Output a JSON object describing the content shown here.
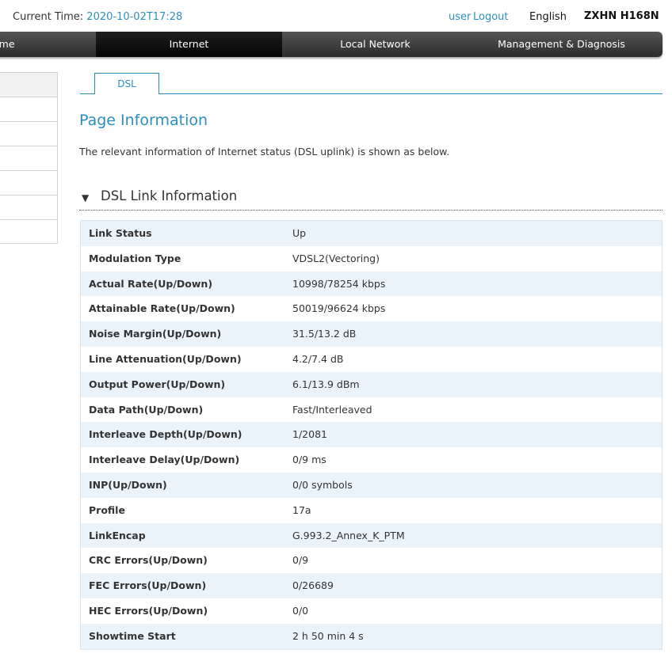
{
  "header": {
    "current_time_label": "Current Time:",
    "current_time_value": "2020-10-02T17:28",
    "user": "user",
    "logout": "Logout",
    "language": "English",
    "model": "ZXHN H168N"
  },
  "nav": {
    "items": [
      {
        "label": "ome"
      },
      {
        "label": "Internet",
        "active": true
      },
      {
        "label": "Local Network"
      },
      {
        "label": "Management & Diagnosis"
      }
    ]
  },
  "tabs": [
    {
      "label": "DSL",
      "active": true
    }
  ],
  "page": {
    "title": "Page Information",
    "description": "The relevant information of Internet status (DSL uplink) is shown as below."
  },
  "section": {
    "toggle_icon": "triangle-down-icon",
    "title": "DSL Link Information"
  },
  "dsl_info": [
    {
      "label": "Link Status",
      "value": "Up"
    },
    {
      "label": "Modulation Type",
      "value": "VDSL2(Vectoring)"
    },
    {
      "label": "Actual Rate(Up/Down)",
      "value": "10998/78254 kbps"
    },
    {
      "label": "Attainable Rate(Up/Down)",
      "value": "50019/96624 kbps"
    },
    {
      "label": "Noise Margin(Up/Down)",
      "value": "31.5/13.2 dB"
    },
    {
      "label": "Line Attenuation(Up/Down)",
      "value": "4.2/7.4 dB"
    },
    {
      "label": "Output Power(Up/Down)",
      "value": "6.1/13.9 dBm"
    },
    {
      "label": "Data Path(Up/Down)",
      "value": "Fast/Interleaved"
    },
    {
      "label": "Interleave Depth(Up/Down)",
      "value": "1/2081"
    },
    {
      "label": "Interleave Delay(Up/Down)",
      "value": "0/9 ms"
    },
    {
      "label": "INP(Up/Down)",
      "value": "0/0 symbols"
    },
    {
      "label": "Profile",
      "value": "17a"
    },
    {
      "label": "LinkEncap",
      "value": "G.993.2_Annex_K_PTM"
    },
    {
      "label": "CRC Errors(Up/Down)",
      "value": "0/9"
    },
    {
      "label": "FEC Errors(Up/Down)",
      "value": "0/26689"
    },
    {
      "label": "HEC Errors(Up/Down)",
      "value": "0/0"
    },
    {
      "label": "Showtime Start",
      "value": "2 h 50 min 4 s"
    }
  ]
}
